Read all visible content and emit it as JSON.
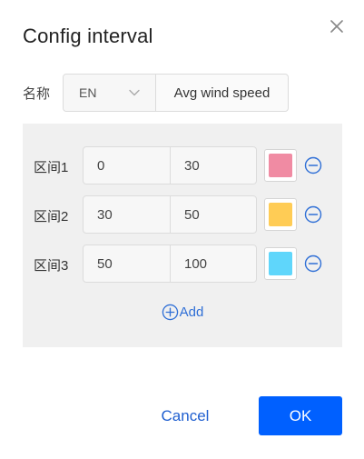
{
  "dialog": {
    "title": "Config interval",
    "close_icon": "close-icon"
  },
  "name_field": {
    "label": "名称",
    "language": "EN",
    "value": "Avg wind speed"
  },
  "intervals": [
    {
      "label": "区间1",
      "from": "0",
      "to": "30",
      "color": "#f08ba3"
    },
    {
      "label": "区间2",
      "from": "30",
      "to": "50",
      "color": "#ffcc55"
    },
    {
      "label": "区间3",
      "from": "50",
      "to": "100",
      "color": "#5fd6fb"
    }
  ],
  "add_label": "Add",
  "buttons": {
    "cancel": "Cancel",
    "ok": "OK"
  },
  "colors": {
    "accent": "#0060ff",
    "link": "#2f6fd6",
    "panel_bg": "#f0f0f0"
  }
}
